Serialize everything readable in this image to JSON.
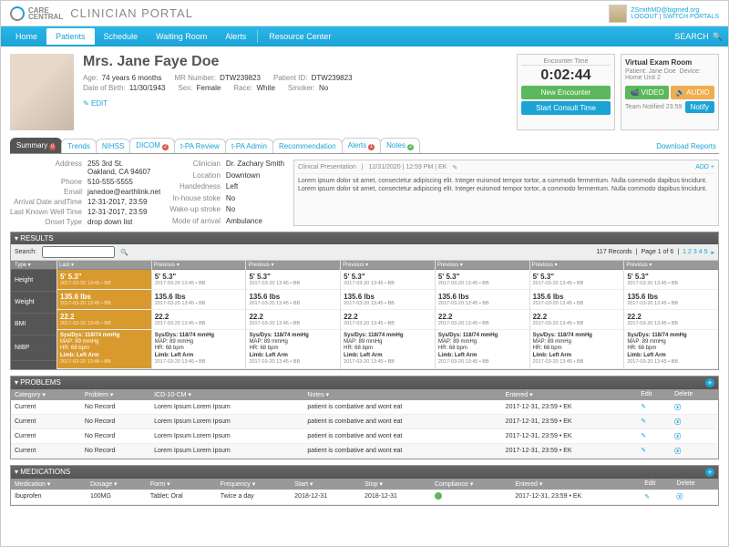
{
  "header": {
    "brand1": "CARE",
    "brand2": "CENTRAL",
    "appname": "CLINICIAN PORTAL",
    "user_email": "ZSmithMD@bigmed.org",
    "logout": "LOGOUT",
    "switch": "SWITCH PORTALS"
  },
  "nav": {
    "home": "Home",
    "patients": "Patients",
    "schedule": "Schedule",
    "waiting": "Waiting Room",
    "alerts": "Alerts",
    "resource": "Resource Center",
    "search": "SEARCH"
  },
  "patient": {
    "name": "Mrs. Jane Faye Doe",
    "age_lbl": "Age:",
    "age": "74 years 6 months",
    "mr_lbl": "MR Number:",
    "mr": "DTW239823",
    "pid_lbl": "Patient ID:",
    "pid": "DTW239823",
    "dob_lbl": "Date of Birth:",
    "dob": "11/30/1943",
    "sex_lbl": "Sex:",
    "sex": "Female",
    "race_lbl": "Race:",
    "race": "White",
    "smoke_lbl": "Smoker:",
    "smoke": "No",
    "edit": "EDIT"
  },
  "encounter": {
    "hdr": "Encounter Time",
    "time": "0:02:44",
    "new": "New Encounter",
    "start": "Start Consult Time"
  },
  "ver": {
    "title": "Virtual Exam Room",
    "pat": "Patient: Jane Doe",
    "dev": "Device: Home Unit 2",
    "video": "VIDEO",
    "audio": "AUDIO",
    "team": "Team Notified 23:59",
    "notify": "Notify"
  },
  "tabs2": {
    "summary": "Summary",
    "trends": "Trends",
    "nihss": "NIHSS",
    "dicom": "DICOM",
    "tpar": "t-PA Review",
    "tpaa": "t-PA Admin",
    "rec": "Recommendation",
    "alerts": "Alerts",
    "notes": "Notes",
    "dl": "Download Reports"
  },
  "badge": {
    "summary": "0",
    "dicom": "2",
    "alerts": "1",
    "notes": "2"
  },
  "addr": {
    "Address": "255 3rd St.\nOakland, CA 94607",
    "Phone": "510-555-5555",
    "Email": "janedoe@earthlink.net",
    "Arrival Date andTime": "12-31-2017, 23:59",
    "Last Known Well Time": "12-31-2017, 23:59",
    "Onset Type": "drop down list"
  },
  "clin": {
    "Clinician": "Dr. Zachary Smith",
    "Location": "Downtown",
    "Handedness": "Left",
    "In-house stoke": "No",
    "Wake-up stroke": "No",
    "Mode of arrival": "Ambulance"
  },
  "pres": {
    "hdr": "Clinical Presentation",
    "ts": "12/31/2020  |  12:59 PM  |  EK",
    "add": "ADD +",
    "body": "Lorem ipsum dolor sit amet, consectetur adipiscing elit. Integer euismod tempor tortor, a commodo fermentum. Nulla commodo dapibus tincidunt. Lorem ipsum dolor sit amet, consectetur adipiscing elit. Integer euismod tempor tortor, a commodo fermentum. Nulla commodo dapibus tincidunt."
  },
  "results": {
    "title": "RESULTS",
    "search": "Search:",
    "records": "117 Records",
    "page": "Page 1 of 6",
    "pages": [
      "1",
      "2",
      "3",
      "4",
      "5"
    ],
    "rowlabels": [
      "Type ▾",
      "Height",
      "Weight",
      "BMI",
      "NIBP"
    ],
    "colhdrs": [
      "Last ▾",
      "Previous ▾",
      "Previous ▾",
      "Previous ▾",
      "Previous ▾",
      "Previous ▾",
      "Previous ▾"
    ],
    "cells": {
      "height": {
        "v": "5' 5.3\"",
        "sub": "2017-03-20 13:45 • BB"
      },
      "weight": {
        "v": "135.6 lbs",
        "sub": "2017-03-20 13:45 • BB"
      },
      "bmi": {
        "v": "22.2",
        "sub": "2017-03-20 13:45 • BB"
      },
      "nibp": {
        "l1": "Sys/Dys: 118/74 mmHg",
        "l2": "MAP:   89 mmHg",
        "l3": "HR:    68 bpm",
        "l4": "Limb:  Left Arm",
        "sub": "2017-03-20 13:45 • BB"
      }
    }
  },
  "problems": {
    "title": "PROBLEMS",
    "cols": [
      "Category ▾",
      "Problem ▾",
      "ICD-10-CM ▾",
      "Notes ▾",
      "Entered ▾",
      "Edit",
      "Delete"
    ],
    "rows": [
      {
        "cat": "Current",
        "prob": "No Record",
        "icd": "Lorem Ipsum",
        "icd2": "Lorem Ipsum",
        "notes": "patient is combative and wont eat",
        "ent": "2017-12-31, 23:59 • EK"
      },
      {
        "cat": "Current",
        "prob": "No Record",
        "icd": "Lorem Ipsum",
        "icd2": "Lorem Ipsum",
        "notes": "patient is combative and wont eat",
        "ent": "2017-12-31, 23:59 • EK"
      },
      {
        "cat": "Current",
        "prob": "No Record",
        "icd": "Lorem Ipsum",
        "icd2": "Lorem Ipsum",
        "notes": "patient is combative and wont eat",
        "ent": "2017-12-31, 23:59 • EK"
      },
      {
        "cat": "Current",
        "prob": "No Record",
        "icd": "Lorem Ipsum",
        "icd2": "Lorem Ipsum",
        "notes": "patient is combative and wont eat",
        "ent": "2017-12-31, 23:59 • EK"
      }
    ]
  },
  "meds": {
    "title": "MEDICATIONS",
    "cols": [
      "Medication ▾",
      "Dosage ▾",
      "Form ▾",
      "Frequency ▾",
      "Start ▾",
      "Stop ▾",
      "Compliance ▾",
      "Entered ▾",
      "Edit",
      "Delete"
    ],
    "rows": [
      {
        "med": "Ibuprofen",
        "dos": "100MG",
        "form": "Tablet; Oral",
        "freq": "Twice a day",
        "start": "2018-12-31",
        "stop": "2018-12-31",
        "comp": "●",
        "ent": "2017-12-31, 23:59 • EK"
      }
    ]
  }
}
